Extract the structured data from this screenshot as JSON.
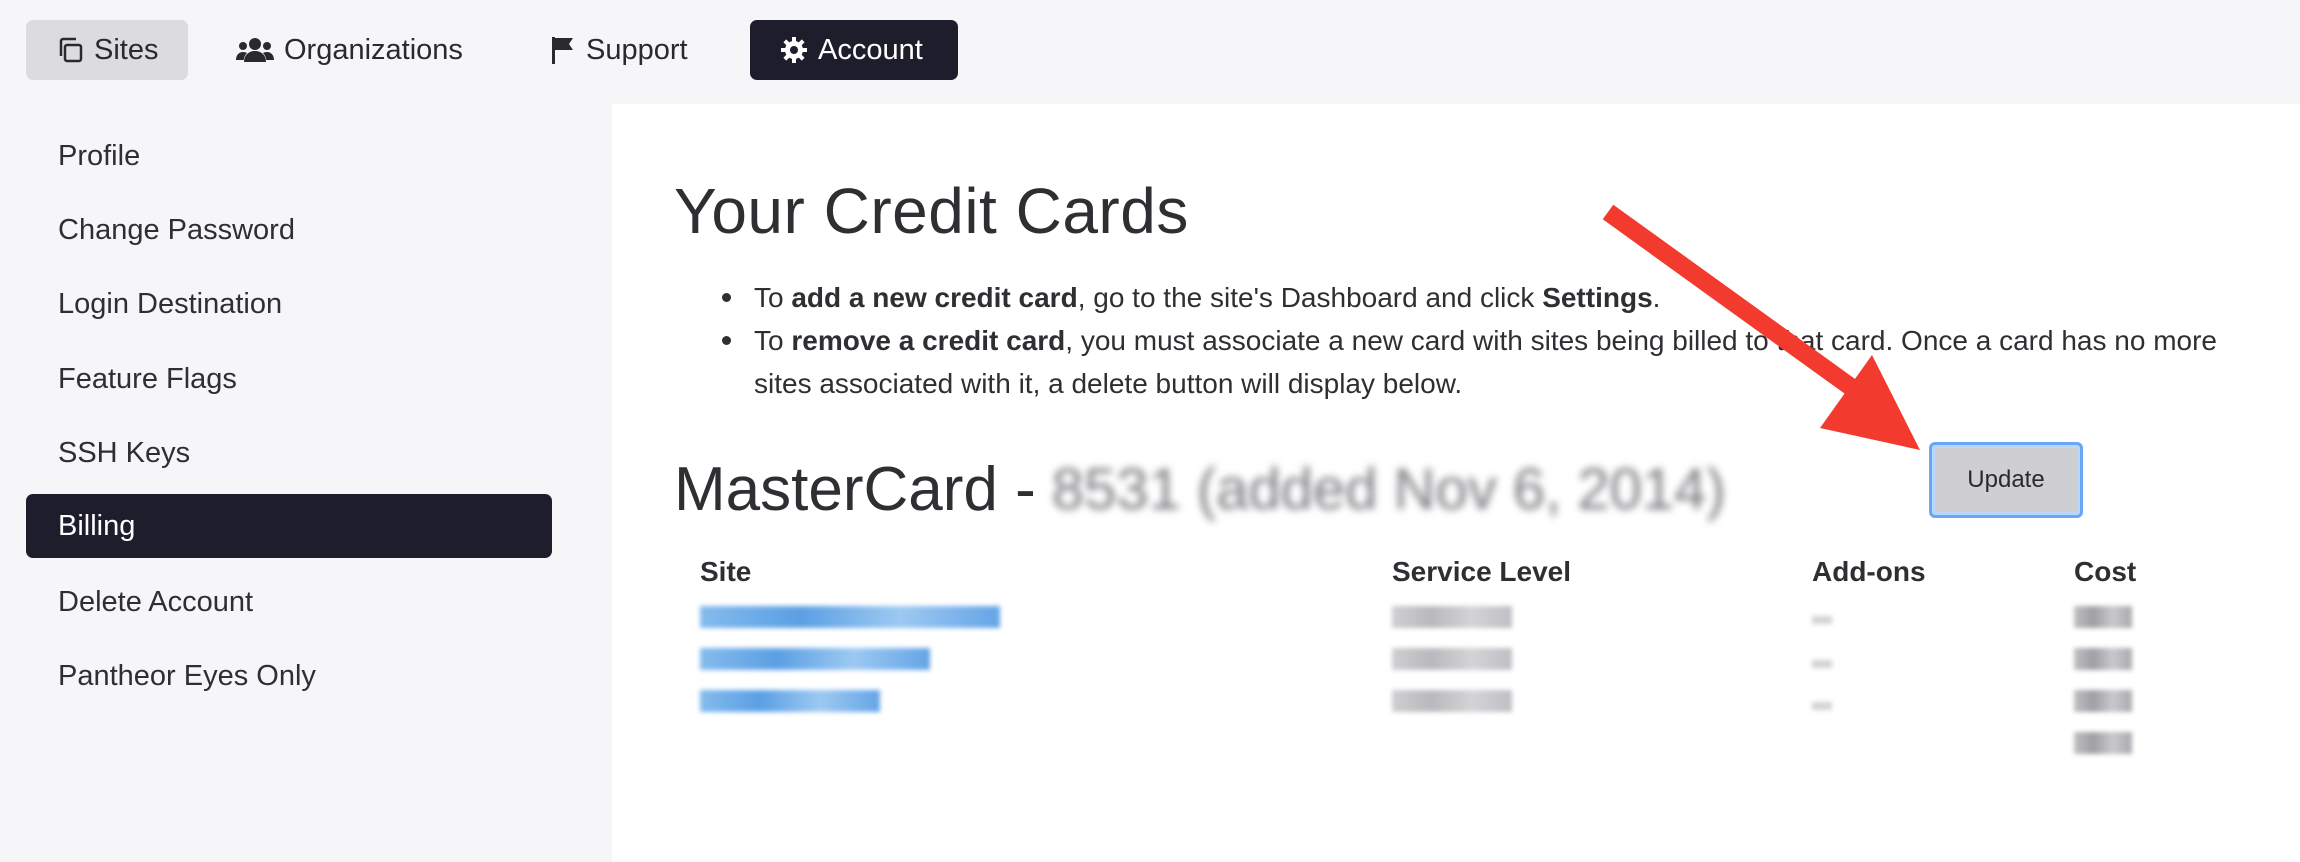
{
  "topnav": {
    "sites": "Sites",
    "organizations": "Organizations",
    "support": "Support",
    "account": "Account"
  },
  "sidebar": {
    "items": [
      {
        "label": "Profile"
      },
      {
        "label": "Change Password"
      },
      {
        "label": "Login Destination"
      },
      {
        "label": "Feature Flags"
      },
      {
        "label": "SSH Keys"
      },
      {
        "label": "Billing"
      },
      {
        "label": "Delete Account"
      },
      {
        "label": "Pantheor Eyes Only"
      }
    ],
    "active": "Billing"
  },
  "main": {
    "title": "Your Credit Cards",
    "bullet1": {
      "pre": "To ",
      "bold1": "add a new credit card",
      "mid": ", go to the site's Dashboard and click ",
      "bold2": "Settings",
      "post": "."
    },
    "bullet2": {
      "pre": "To ",
      "bold1": "remove a credit card",
      "post": ", you must associate a new card with sites being billed to that card. Once a card has no more sites associated with it, a delete button will display below."
    },
    "card": {
      "brand": "MasterCard -",
      "details_redacted": "8531 (added Nov 6, 2014)"
    },
    "update_label": "Update",
    "table": {
      "headers": [
        "Site",
        "Service Level",
        "Add-ons",
        "Cost"
      ]
    }
  },
  "colors": {
    "nav_active_bg": "#1d1d2b",
    "arrow": "#f23a2e",
    "update_border": "#6aa6f2"
  }
}
